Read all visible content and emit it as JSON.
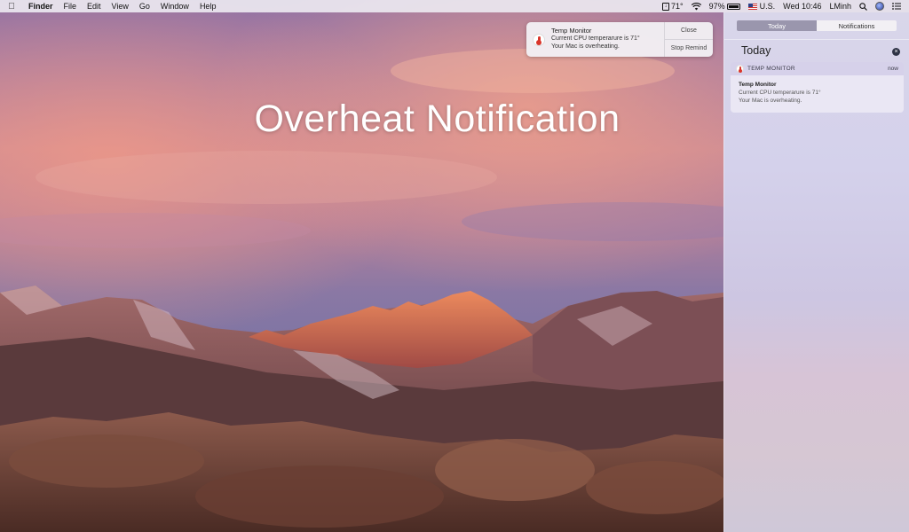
{
  "menubar": {
    "apple_icon": "apple-icon",
    "app_name": "Finder",
    "menus": [
      "File",
      "Edit",
      "View",
      "Go",
      "Window",
      "Help"
    ],
    "temperature": "71°",
    "battery_percent": "97%",
    "input_source": "U.S.",
    "clock": "Wed 10:46",
    "user": "LMinh"
  },
  "overlay": {
    "title": "Overheat Notification"
  },
  "banner": {
    "title": "Temp Monitor",
    "line1": "Current CPU temperarure is 71°",
    "line2": "Your Mac is overheating.",
    "close_label": "Close",
    "stop_label": "Stop Remind"
  },
  "notification_center": {
    "tabs": [
      {
        "label": "Today",
        "active": true
      },
      {
        "label": "Notifications",
        "active": false
      }
    ],
    "section_title": "Today",
    "clear_icon": "close-circle-icon",
    "card": {
      "app": "TEMP MONITOR",
      "time": "now",
      "title": "Temp Monitor",
      "line1": "Current CPU temperarure is 71°",
      "line2": "Your Mac is overheating."
    }
  },
  "colors": {
    "thermometer_red": "#d9352b",
    "segment_active": "#9a96ad"
  }
}
